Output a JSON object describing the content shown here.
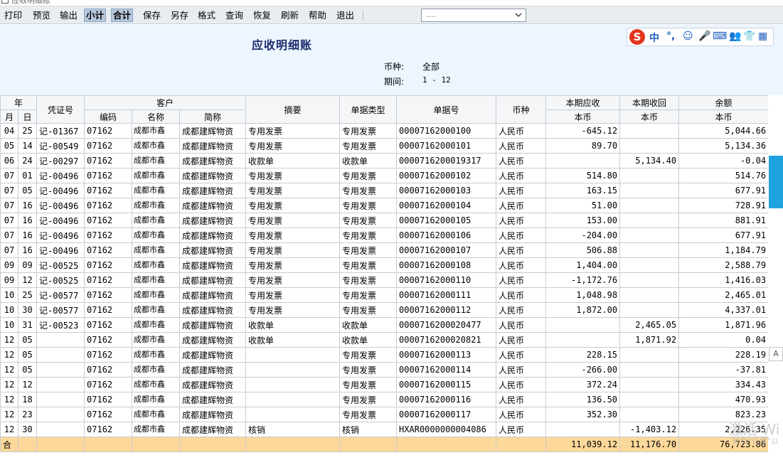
{
  "window": {
    "title": "应收明细账"
  },
  "toolbar": {
    "buttons": [
      {
        "label": "打印"
      },
      {
        "label": "预览"
      },
      {
        "label": "输出"
      },
      {
        "label": "小计"
      },
      {
        "label": "合计"
      },
      {
        "label": "保存"
      },
      {
        "label": "另存"
      },
      {
        "label": "格式"
      },
      {
        "label": "查询"
      },
      {
        "label": "恢复"
      },
      {
        "label": "刷新"
      },
      {
        "label": "帮助"
      },
      {
        "label": "退出"
      }
    ],
    "select_value": "...."
  },
  "report": {
    "title": "应收明细账",
    "currency_label": "币种:",
    "currency_value": "全部",
    "period_label": "期间:",
    "period_value": "1  -  12"
  },
  "ime": {
    "logo": "S",
    "glyphs": [
      "中",
      "°,",
      "☺",
      "🎤",
      "⌨",
      "👥",
      "👕",
      "▦"
    ]
  },
  "columns": {
    "year": "年",
    "month": "月",
    "day": "日",
    "voucher": "凭证号",
    "customer": "客户",
    "code": "编码",
    "name": "名称",
    "abbr": "简称",
    "summary": "摘要",
    "doc_type": "单据类型",
    "doc_no": "单据号",
    "currency": "币种",
    "receivable": "本期应收",
    "received": "本期收回",
    "balance": "余额",
    "local": "本币"
  },
  "rows": [
    {
      "m": "04",
      "d": "25",
      "v": "记-01367",
      "code": "07162",
      "name": "成都市鑫",
      "abbr": "成都建辉物资",
      "sum": "专用发票",
      "type": "专用发票",
      "no": "00007162000100",
      "cur": "人民币",
      "rec": "-645.12",
      "got": "",
      "bal": "5,044.66"
    },
    {
      "m": "05",
      "d": "14",
      "v": "记-00549",
      "code": "07162",
      "name": "成都市鑫",
      "abbr": "成都建辉物资",
      "sum": "专用发票",
      "type": "专用发票",
      "no": "00007162000101",
      "cur": "人民币",
      "rec": "89.70",
      "got": "",
      "bal": "5,134.36"
    },
    {
      "m": "06",
      "d": "24",
      "v": "记-00297",
      "code": "07162",
      "name": "成都市鑫",
      "abbr": "成都建辉物资",
      "sum": "收款单",
      "type": "收款单",
      "no": "0000716200019317",
      "cur": "人民币",
      "rec": "",
      "got": "5,134.40",
      "bal": "-0.04"
    },
    {
      "m": "07",
      "d": "01",
      "v": "记-00496",
      "code": "07162",
      "name": "成都市鑫",
      "abbr": "成都建辉物资",
      "sum": "专用发票",
      "type": "专用发票",
      "no": "00007162000102",
      "cur": "人民币",
      "rec": "514.80",
      "got": "",
      "bal": "514.76"
    },
    {
      "m": "07",
      "d": "05",
      "v": "记-00496",
      "code": "07162",
      "name": "成都市鑫",
      "abbr": "成都建辉物资",
      "sum": "专用发票",
      "type": "专用发票",
      "no": "00007162000103",
      "cur": "人民币",
      "rec": "163.15",
      "got": "",
      "bal": "677.91"
    },
    {
      "m": "07",
      "d": "16",
      "v": "记-00496",
      "code": "07162",
      "name": "成都市鑫",
      "abbr": "成都建辉物资",
      "sum": "专用发票",
      "type": "专用发票",
      "no": "00007162000104",
      "cur": "人民币",
      "rec": "51.00",
      "got": "",
      "bal": "728.91"
    },
    {
      "m": "07",
      "d": "16",
      "v": "记-00496",
      "code": "07162",
      "name": "成都市鑫",
      "abbr": "成都建辉物资",
      "sum": "专用发票",
      "type": "专用发票",
      "no": "00007162000105",
      "cur": "人民币",
      "rec": "153.00",
      "got": "",
      "bal": "881.91"
    },
    {
      "m": "07",
      "d": "16",
      "v": "记-00496",
      "code": "07162",
      "name": "成都市鑫",
      "abbr": "成都建辉物资",
      "sum": "专用发票",
      "type": "专用发票",
      "no": "00007162000106",
      "cur": "人民币",
      "rec": "-204.00",
      "got": "",
      "bal": "677.91"
    },
    {
      "m": "07",
      "d": "16",
      "v": "记-00496",
      "code": "07162",
      "name": "成都市鑫",
      "abbr": "成都建辉物资",
      "sum": "专用发票",
      "type": "专用发票",
      "no": "00007162000107",
      "cur": "人民币",
      "rec": "506.88",
      "got": "",
      "bal": "1,184.79"
    },
    {
      "m": "09",
      "d": "09",
      "v": "记-00525",
      "code": "07162",
      "name": "成都市鑫",
      "abbr": "成都建辉物资",
      "sum": "专用发票",
      "type": "专用发票",
      "no": "00007162000108",
      "cur": "人民币",
      "rec": "1,404.00",
      "got": "",
      "bal": "2,588.79"
    },
    {
      "m": "09",
      "d": "12",
      "v": "记-00525",
      "code": "07162",
      "name": "成都市鑫",
      "abbr": "成都建辉物资",
      "sum": "专用发票",
      "type": "专用发票",
      "no": "00007162000110",
      "cur": "人民币",
      "rec": "-1,172.76",
      "got": "",
      "bal": "1,416.03"
    },
    {
      "m": "10",
      "d": "25",
      "v": "记-00577",
      "code": "07162",
      "name": "成都市鑫",
      "abbr": "成都建辉物资",
      "sum": "专用发票",
      "type": "专用发票",
      "no": "00007162000111",
      "cur": "人民币",
      "rec": "1,048.98",
      "got": "",
      "bal": "2,465.01"
    },
    {
      "m": "10",
      "d": "30",
      "v": "记-00577",
      "code": "07162",
      "name": "成都市鑫",
      "abbr": "成都建辉物资",
      "sum": "专用发票",
      "type": "专用发票",
      "no": "00007162000112",
      "cur": "人民币",
      "rec": "1,872.00",
      "got": "",
      "bal": "4,337.01"
    },
    {
      "m": "10",
      "d": "31",
      "v": "记-00523",
      "code": "07162",
      "name": "成都市鑫",
      "abbr": "成都建辉物资",
      "sum": "收款单",
      "type": "收款单",
      "no": "0000716200020477",
      "cur": "人民币",
      "rec": "",
      "got": "2,465.05",
      "bal": "1,871.96"
    },
    {
      "m": "12",
      "d": "05",
      "v": "",
      "code": "07162",
      "name": "成都市鑫",
      "abbr": "成都建辉物资",
      "sum": "收款单",
      "type": "收款单",
      "no": "0000716200020821",
      "cur": "人民币",
      "rec": "",
      "got": "1,871.92",
      "bal": "0.04"
    },
    {
      "m": "12",
      "d": "05",
      "v": "",
      "code": "07162",
      "name": "成都市鑫",
      "abbr": "成都建辉物资",
      "sum": "",
      "type": "专用发票",
      "no": "00007162000113",
      "cur": "人民币",
      "rec": "228.15",
      "got": "",
      "bal": "228.19"
    },
    {
      "m": "12",
      "d": "05",
      "v": "",
      "code": "07162",
      "name": "成都市鑫",
      "abbr": "成都建辉物资",
      "sum": "",
      "type": "专用发票",
      "no": "00007162000114",
      "cur": "人民币",
      "rec": "-266.00",
      "got": "",
      "bal": "-37.81"
    },
    {
      "m": "12",
      "d": "12",
      "v": "",
      "code": "07162",
      "name": "成都市鑫",
      "abbr": "成都建辉物资",
      "sum": "",
      "type": "专用发票",
      "no": "00007162000115",
      "cur": "人民币",
      "rec": "372.24",
      "got": "",
      "bal": "334.43"
    },
    {
      "m": "12",
      "d": "18",
      "v": "",
      "code": "07162",
      "name": "成都市鑫",
      "abbr": "成都建辉物资",
      "sum": "",
      "type": "专用发票",
      "no": "00007162000116",
      "cur": "人民币",
      "rec": "136.50",
      "got": "",
      "bal": "470.93"
    },
    {
      "m": "12",
      "d": "23",
      "v": "",
      "code": "07162",
      "name": "成都市鑫",
      "abbr": "成都建辉物资",
      "sum": "",
      "type": "专用发票",
      "no": "00007162000117",
      "cur": "人民币",
      "rec": "352.30",
      "got": "",
      "bal": "823.23"
    },
    {
      "m": "12",
      "d": "30",
      "v": "",
      "code": "07162",
      "name": "成都市鑫",
      "abbr": "成都建辉物资",
      "sum": "核销",
      "type": "核销",
      "no": "HXAR0000000004086",
      "cur": "人民币",
      "rec": "",
      "got": "-1,403.12",
      "bal": "2,226.35"
    }
  ],
  "total": {
    "label": "合",
    "rec": "11,039.12",
    "got": "11,176.70",
    "bal": "76,723.86"
  },
  "side": {
    "letter": "A"
  },
  "watermark": {
    "line1": "激活 Wi",
    "line2": "转到\"设置\"以"
  },
  "colors": {
    "toolbar_bg": "#e8edf2",
    "header_bg": "#edf6ff",
    "total_bg": "#fcd99a",
    "title_color": "#1a2a6c",
    "side_tab": "#1fa3e0"
  }
}
